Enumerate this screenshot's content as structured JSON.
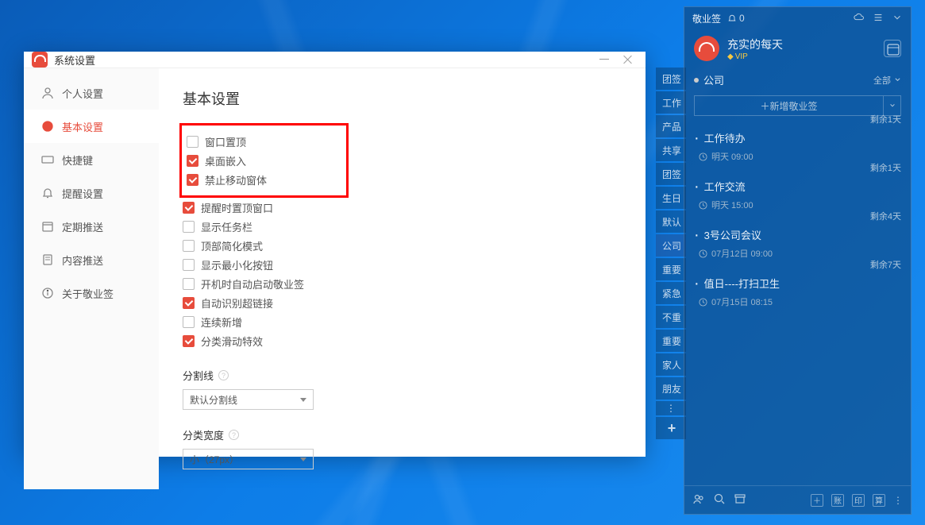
{
  "settings": {
    "title": "系统设置",
    "sidebar": {
      "items": [
        {
          "label": "个人设置"
        },
        {
          "label": "基本设置"
        },
        {
          "label": "快捷键"
        },
        {
          "label": "提醒设置"
        },
        {
          "label": "定期推送"
        },
        {
          "label": "内容推送"
        },
        {
          "label": "关于敬业签"
        }
      ],
      "selected_index": 1
    },
    "content": {
      "heading": "基本设置",
      "checkboxes": [
        {
          "label": "窗口置顶",
          "checked": false,
          "highlighted": true
        },
        {
          "label": "桌面嵌入",
          "checked": true,
          "highlighted": true
        },
        {
          "label": "禁止移动窗体",
          "checked": true,
          "highlighted": true
        },
        {
          "label": "提醒时置顶窗口",
          "checked": true,
          "highlighted": false
        },
        {
          "label": "显示任务栏",
          "checked": false,
          "highlighted": false
        },
        {
          "label": "顶部简化模式",
          "checked": false,
          "highlighted": false
        },
        {
          "label": "显示最小化按钮",
          "checked": false,
          "highlighted": false
        },
        {
          "label": "开机时自动启动敬业签",
          "checked": false,
          "highlighted": false
        },
        {
          "label": "自动识别超链接",
          "checked": true,
          "highlighted": false
        },
        {
          "label": "连续新增",
          "checked": false,
          "highlighted": false
        },
        {
          "label": "分类滑动特效",
          "checked": true,
          "highlighted": false
        }
      ],
      "divider_label": "分割线",
      "divider_value": "默认分割线",
      "width_label": "分类宽度",
      "width_value": "小（27px）"
    }
  },
  "bg_tags": [
    "团签",
    "工作",
    "产品",
    "共享",
    "团签",
    "生日",
    "默认",
    "公司",
    "重要",
    "紧急",
    "不重",
    "重要",
    "家人",
    "朋友"
  ],
  "bg_tags_active_index": 7,
  "widget": {
    "app_name": "敬业签",
    "notif_count": "0",
    "user_name": "充实的每天",
    "vip_label": "VIP",
    "category": "公司",
    "filter_label": "全部",
    "add_label": "＋新增敬业签",
    "items": [
      {
        "remain": "剩余1天",
        "title": "工作待办",
        "time": "明天 09:00"
      },
      {
        "remain": "剩余1天",
        "title": "工作交流",
        "time": "明天 15:00"
      },
      {
        "remain": "剩余4天",
        "title": "3号公司会议",
        "time": "07月12日 09:00"
      },
      {
        "remain": "剩余7天",
        "title": "值日----打扫卫生",
        "time": "07月15日 08:15"
      }
    ],
    "bottom_right": [
      "＋",
      "账",
      "印",
      "算"
    ]
  }
}
